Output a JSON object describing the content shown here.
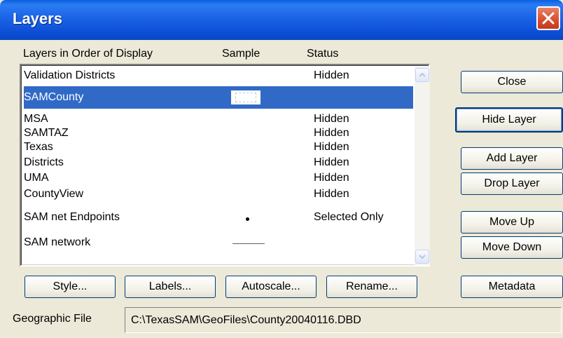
{
  "window": {
    "title": "Layers"
  },
  "list": {
    "headers": {
      "layers": "Layers in Order of Display",
      "sample": "Sample",
      "status": "Status"
    },
    "rows": [
      {
        "name": "Validation Districts",
        "status": "Hidden",
        "sample": "none"
      },
      {
        "name": "SAMCounty",
        "status": "",
        "sample": "dashed-box",
        "selected": true
      },
      {
        "name": "MSA",
        "status": "Hidden",
        "sample": "none"
      },
      {
        "name": "SAMTAZ",
        "status": "Hidden",
        "sample": "none"
      },
      {
        "name": "Texas",
        "status": "Hidden",
        "sample": "none"
      },
      {
        "name": "Districts",
        "status": "Hidden",
        "sample": "none"
      },
      {
        "name": "UMA",
        "status": "Hidden",
        "sample": "none"
      },
      {
        "name": "CountyView",
        "status": "Hidden",
        "sample": "none"
      },
      {
        "name": "SAM net Endpoints",
        "status": "Selected Only",
        "sample": "dot"
      },
      {
        "name": "SAM network",
        "status": "",
        "sample": "line"
      }
    ]
  },
  "buttons": {
    "close": "Close",
    "hide_layer": "Hide Layer",
    "add_layer": "Add Layer",
    "drop_layer": "Drop Layer",
    "move_up": "Move Up",
    "move_down": "Move Down",
    "metadata": "Metadata",
    "style": "Style...",
    "labels": "Labels...",
    "autoscale": "Autoscale...",
    "rename": "Rename..."
  },
  "geographic_file": {
    "label": "Geographic File",
    "value": "C:\\TexasSAM\\GeoFiles\\County20040116.DBD"
  },
  "colors": {
    "titlebar": "#0a5fe0",
    "selection": "#3169c6",
    "dialog_bg": "#ece9d8",
    "close_button": "#d84d2e"
  }
}
